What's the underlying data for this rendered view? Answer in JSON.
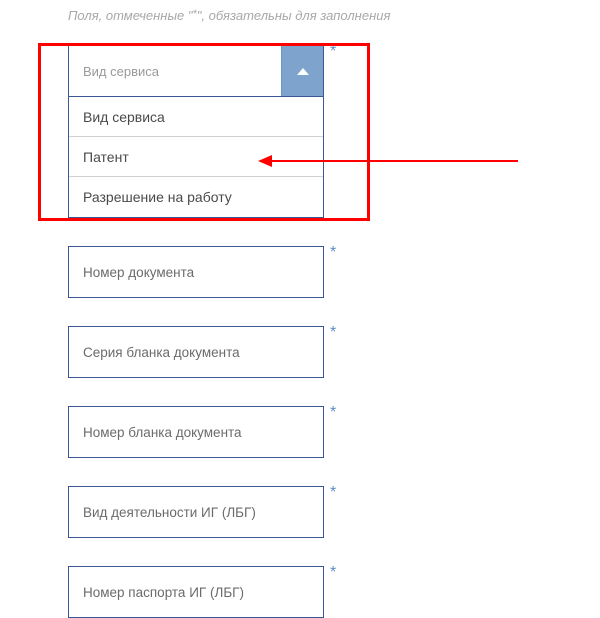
{
  "instruction": {
    "prefix": "Поля, отмеченные \"",
    "mark": "*",
    "suffix": "\", обязательны для заполнения"
  },
  "dropdown": {
    "placeholder": "Вид сервиса",
    "options": [
      "Вид сервиса",
      "Патент",
      "Разрешение на работу"
    ]
  },
  "fields": [
    {
      "placeholder": "Номер документа"
    },
    {
      "placeholder": "Серия бланка документа"
    },
    {
      "placeholder": "Номер бланка документа"
    },
    {
      "placeholder": "Вид деятельности ИГ (ЛБГ)"
    },
    {
      "placeholder": "Номер паспорта ИГ (ЛБГ)"
    }
  ],
  "required_mark": "*"
}
